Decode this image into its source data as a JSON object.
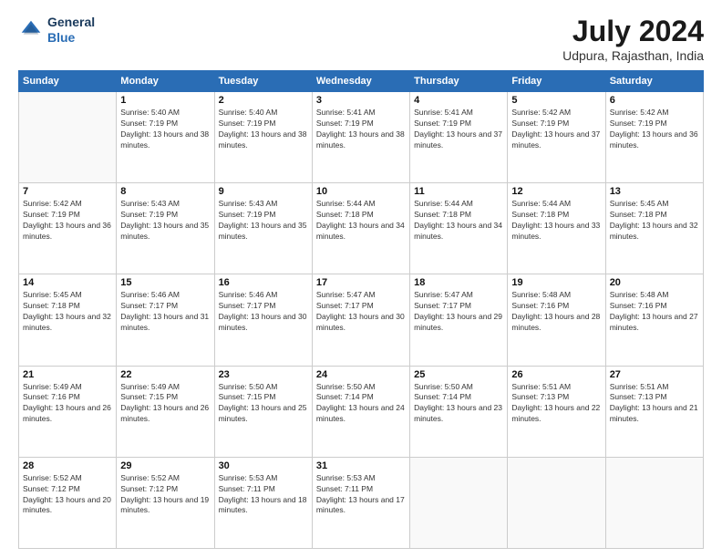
{
  "logo": {
    "line1": "General",
    "line2": "Blue"
  },
  "title": "July 2024",
  "subtitle": "Udpura, Rajasthan, India",
  "header_days": [
    "Sunday",
    "Monday",
    "Tuesday",
    "Wednesday",
    "Thursday",
    "Friday",
    "Saturday"
  ],
  "weeks": [
    [
      {
        "day": "",
        "sunrise": "",
        "sunset": "",
        "daylight": ""
      },
      {
        "day": "1",
        "sunrise": "Sunrise: 5:40 AM",
        "sunset": "Sunset: 7:19 PM",
        "daylight": "Daylight: 13 hours and 38 minutes."
      },
      {
        "day": "2",
        "sunrise": "Sunrise: 5:40 AM",
        "sunset": "Sunset: 7:19 PM",
        "daylight": "Daylight: 13 hours and 38 minutes."
      },
      {
        "day": "3",
        "sunrise": "Sunrise: 5:41 AM",
        "sunset": "Sunset: 7:19 PM",
        "daylight": "Daylight: 13 hours and 38 minutes."
      },
      {
        "day": "4",
        "sunrise": "Sunrise: 5:41 AM",
        "sunset": "Sunset: 7:19 PM",
        "daylight": "Daylight: 13 hours and 37 minutes."
      },
      {
        "day": "5",
        "sunrise": "Sunrise: 5:42 AM",
        "sunset": "Sunset: 7:19 PM",
        "daylight": "Daylight: 13 hours and 37 minutes."
      },
      {
        "day": "6",
        "sunrise": "Sunrise: 5:42 AM",
        "sunset": "Sunset: 7:19 PM",
        "daylight": "Daylight: 13 hours and 36 minutes."
      }
    ],
    [
      {
        "day": "7",
        "sunrise": "Sunrise: 5:42 AM",
        "sunset": "Sunset: 7:19 PM",
        "daylight": "Daylight: 13 hours and 36 minutes."
      },
      {
        "day": "8",
        "sunrise": "Sunrise: 5:43 AM",
        "sunset": "Sunset: 7:19 PM",
        "daylight": "Daylight: 13 hours and 35 minutes."
      },
      {
        "day": "9",
        "sunrise": "Sunrise: 5:43 AM",
        "sunset": "Sunset: 7:19 PM",
        "daylight": "Daylight: 13 hours and 35 minutes."
      },
      {
        "day": "10",
        "sunrise": "Sunrise: 5:44 AM",
        "sunset": "Sunset: 7:18 PM",
        "daylight": "Daylight: 13 hours and 34 minutes."
      },
      {
        "day": "11",
        "sunrise": "Sunrise: 5:44 AM",
        "sunset": "Sunset: 7:18 PM",
        "daylight": "Daylight: 13 hours and 34 minutes."
      },
      {
        "day": "12",
        "sunrise": "Sunrise: 5:44 AM",
        "sunset": "Sunset: 7:18 PM",
        "daylight": "Daylight: 13 hours and 33 minutes."
      },
      {
        "day": "13",
        "sunrise": "Sunrise: 5:45 AM",
        "sunset": "Sunset: 7:18 PM",
        "daylight": "Daylight: 13 hours and 32 minutes."
      }
    ],
    [
      {
        "day": "14",
        "sunrise": "Sunrise: 5:45 AM",
        "sunset": "Sunset: 7:18 PM",
        "daylight": "Daylight: 13 hours and 32 minutes."
      },
      {
        "day": "15",
        "sunrise": "Sunrise: 5:46 AM",
        "sunset": "Sunset: 7:17 PM",
        "daylight": "Daylight: 13 hours and 31 minutes."
      },
      {
        "day": "16",
        "sunrise": "Sunrise: 5:46 AM",
        "sunset": "Sunset: 7:17 PM",
        "daylight": "Daylight: 13 hours and 30 minutes."
      },
      {
        "day": "17",
        "sunrise": "Sunrise: 5:47 AM",
        "sunset": "Sunset: 7:17 PM",
        "daylight": "Daylight: 13 hours and 30 minutes."
      },
      {
        "day": "18",
        "sunrise": "Sunrise: 5:47 AM",
        "sunset": "Sunset: 7:17 PM",
        "daylight": "Daylight: 13 hours and 29 minutes."
      },
      {
        "day": "19",
        "sunrise": "Sunrise: 5:48 AM",
        "sunset": "Sunset: 7:16 PM",
        "daylight": "Daylight: 13 hours and 28 minutes."
      },
      {
        "day": "20",
        "sunrise": "Sunrise: 5:48 AM",
        "sunset": "Sunset: 7:16 PM",
        "daylight": "Daylight: 13 hours and 27 minutes."
      }
    ],
    [
      {
        "day": "21",
        "sunrise": "Sunrise: 5:49 AM",
        "sunset": "Sunset: 7:16 PM",
        "daylight": "Daylight: 13 hours and 26 minutes."
      },
      {
        "day": "22",
        "sunrise": "Sunrise: 5:49 AM",
        "sunset": "Sunset: 7:15 PM",
        "daylight": "Daylight: 13 hours and 26 minutes."
      },
      {
        "day": "23",
        "sunrise": "Sunrise: 5:50 AM",
        "sunset": "Sunset: 7:15 PM",
        "daylight": "Daylight: 13 hours and 25 minutes."
      },
      {
        "day": "24",
        "sunrise": "Sunrise: 5:50 AM",
        "sunset": "Sunset: 7:14 PM",
        "daylight": "Daylight: 13 hours and 24 minutes."
      },
      {
        "day": "25",
        "sunrise": "Sunrise: 5:50 AM",
        "sunset": "Sunset: 7:14 PM",
        "daylight": "Daylight: 13 hours and 23 minutes."
      },
      {
        "day": "26",
        "sunrise": "Sunrise: 5:51 AM",
        "sunset": "Sunset: 7:13 PM",
        "daylight": "Daylight: 13 hours and 22 minutes."
      },
      {
        "day": "27",
        "sunrise": "Sunrise: 5:51 AM",
        "sunset": "Sunset: 7:13 PM",
        "daylight": "Daylight: 13 hours and 21 minutes."
      }
    ],
    [
      {
        "day": "28",
        "sunrise": "Sunrise: 5:52 AM",
        "sunset": "Sunset: 7:12 PM",
        "daylight": "Daylight: 13 hours and 20 minutes."
      },
      {
        "day": "29",
        "sunrise": "Sunrise: 5:52 AM",
        "sunset": "Sunset: 7:12 PM",
        "daylight": "Daylight: 13 hours and 19 minutes."
      },
      {
        "day": "30",
        "sunrise": "Sunrise: 5:53 AM",
        "sunset": "Sunset: 7:11 PM",
        "daylight": "Daylight: 13 hours and 18 minutes."
      },
      {
        "day": "31",
        "sunrise": "Sunrise: 5:53 AM",
        "sunset": "Sunset: 7:11 PM",
        "daylight": "Daylight: 13 hours and 17 minutes."
      },
      {
        "day": "",
        "sunrise": "",
        "sunset": "",
        "daylight": ""
      },
      {
        "day": "",
        "sunrise": "",
        "sunset": "",
        "daylight": ""
      },
      {
        "day": "",
        "sunrise": "",
        "sunset": "",
        "daylight": ""
      }
    ]
  ]
}
